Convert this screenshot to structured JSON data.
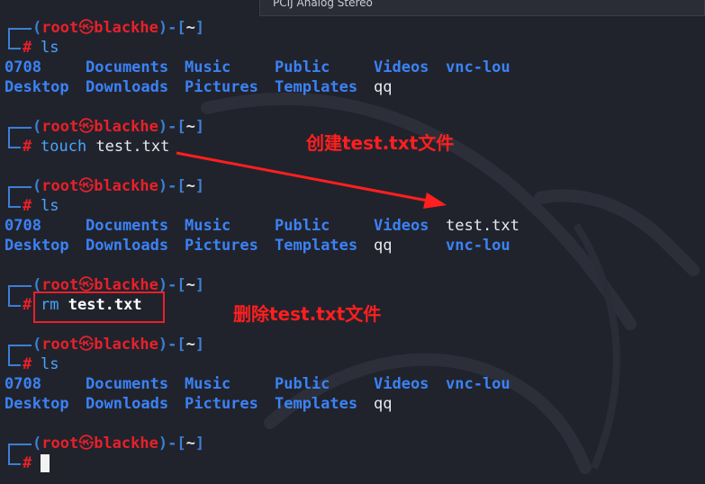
{
  "window": {
    "title": "PCIJ Analog Stereo"
  },
  "prompt": {
    "user": "root",
    "skull": "㉿",
    "host": "blackhe",
    "dir": "~",
    "symbol": "#"
  },
  "commands": [
    {
      "cmd": "ls"
    },
    {
      "cmd": "touch",
      "arg": "test.txt"
    },
    {
      "cmd": "ls"
    },
    {
      "cmd": "rm",
      "arg": "test.txt"
    },
    {
      "cmd": "ls"
    }
  ],
  "ls_outputs": [
    {
      "line1": [
        "0708",
        "Documents",
        "Music",
        "Public",
        "Videos",
        "vnc-lou"
      ],
      "line2": [
        "Desktop",
        "Downloads",
        "Pictures",
        "Templates",
        "qq"
      ]
    },
    {
      "line1": [
        "0708",
        "Documents",
        "Music",
        "Public",
        "Videos",
        "test.txt"
      ],
      "line2": [
        "Desktop",
        "Downloads",
        "Pictures",
        "Templates",
        "qq",
        "vnc-lou"
      ]
    },
    {
      "line1": [
        "0708",
        "Documents",
        "Music",
        "Public",
        "Videos",
        "vnc-lou"
      ],
      "line2": [
        "Desktop",
        "Downloads",
        "Pictures",
        "Templates",
        "qq"
      ]
    }
  ],
  "annotations": {
    "create": "创建test.txt文件",
    "delete": "删除test.txt文件"
  },
  "colors": {
    "background": "#21232c",
    "prompt_red": "#e8202a",
    "dir_blue": "#3b82f6",
    "annotation_red": "#ff1f1f"
  }
}
